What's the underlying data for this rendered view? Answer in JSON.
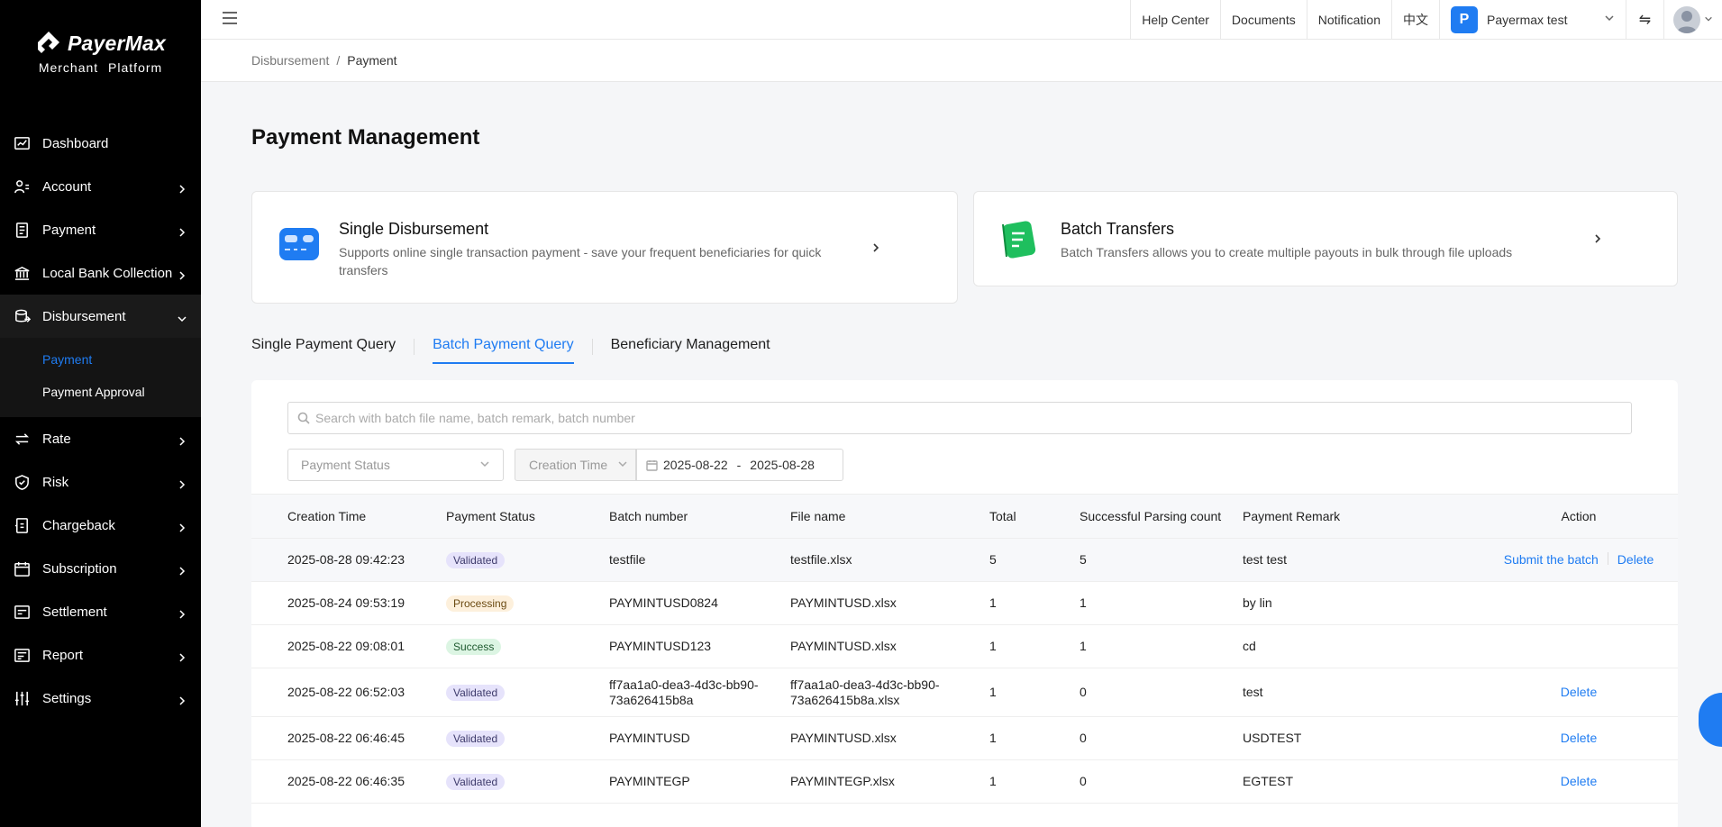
{
  "brand": {
    "name": "PayerMax",
    "sub": "Merchant Platform"
  },
  "sidebar": {
    "items": [
      {
        "label": "Dashboard"
      },
      {
        "label": "Account"
      },
      {
        "label": "Payment"
      },
      {
        "label": "Local Bank Collection"
      },
      {
        "label": "Disbursement"
      },
      {
        "label": "Rate"
      },
      {
        "label": "Risk"
      },
      {
        "label": "Chargeback"
      },
      {
        "label": "Subscription"
      },
      {
        "label": "Settlement"
      },
      {
        "label": "Report"
      },
      {
        "label": "Settings"
      }
    ],
    "subitems": [
      {
        "label": "Payment"
      },
      {
        "label": "Payment Approval"
      }
    ]
  },
  "topbar": {
    "help": "Help Center",
    "docs": "Documents",
    "notif": "Notification",
    "lang": "中文",
    "badge": "P",
    "account": "Payermax test"
  },
  "breadcrumb": {
    "parent": "Disbursement",
    "sep": "/",
    "current": "Payment"
  },
  "page_title": "Payment Management",
  "cards": {
    "single": {
      "title": "Single Disbursement",
      "desc": "Supports online single transaction payment - save your frequent beneficiaries for quick transfers"
    },
    "batch": {
      "title": "Batch Transfers",
      "desc": "Batch Transfers allows you to create multiple payouts in bulk through file uploads"
    }
  },
  "tabs": [
    {
      "label": "Single Payment Query"
    },
    {
      "label": "Batch Payment Query"
    },
    {
      "label": "Beneficiary Management"
    }
  ],
  "filters": {
    "search_placeholder": "Search with batch file name, batch remark, batch number",
    "status_placeholder": "Payment Status",
    "time_select": "Creation Time",
    "date_from": "2025-08-22",
    "date_sep": "-",
    "date_to": "2025-08-28"
  },
  "table": {
    "headers": [
      "Creation Time",
      "Payment Status",
      "Batch number",
      "File name",
      "Total",
      "Successful Parsing count",
      "Payment Remark",
      "Action"
    ],
    "rows": [
      {
        "time": "2025-08-28 09:42:23",
        "status": "Validated",
        "batch": "testfile",
        "file": "testfile.xlsx",
        "total": "5",
        "parsed": "5",
        "remark": "test test",
        "act1": "Submit the batch",
        "act2": "Delete"
      },
      {
        "time": "2025-08-24 09:53:19",
        "status": "Processing",
        "batch": "PAYMINTUSD0824",
        "file": "PAYMINTUSD.xlsx",
        "total": "1",
        "parsed": "1",
        "remark": "by lin",
        "act1": "",
        "act2": ""
      },
      {
        "time": "2025-08-22 09:08:01",
        "status": "Success",
        "batch": "PAYMINTUSD123",
        "file": "PAYMINTUSD.xlsx",
        "total": "1",
        "parsed": "1",
        "remark": "cd",
        "act1": "",
        "act2": ""
      },
      {
        "time": "2025-08-22 06:52:03",
        "status": "Validated",
        "batch": "ff7aa1a0-dea3-4d3c-bb90-73a626415b8a",
        "file": "ff7aa1a0-dea3-4d3c-bb90-73a626415b8a.xlsx",
        "total": "1",
        "parsed": "0",
        "remark": "test",
        "act1": "",
        "act2": "Delete"
      },
      {
        "time": "2025-08-22 06:46:45",
        "status": "Validated",
        "batch": "PAYMINTUSD",
        "file": "PAYMINTUSD.xlsx",
        "total": "1",
        "parsed": "0",
        "remark": "USDTEST",
        "act1": "",
        "act2": "Delete"
      },
      {
        "time": "2025-08-22 06:46:35",
        "status": "Validated",
        "batch": "PAYMINTEGP",
        "file": "PAYMINTEGP.xlsx",
        "total": "1",
        "parsed": "0",
        "remark": "EGTEST",
        "act1": "",
        "act2": "Delete"
      }
    ]
  },
  "colors": {
    "accent": "#1f7cf2",
    "sidebar_bg": "#000000"
  }
}
